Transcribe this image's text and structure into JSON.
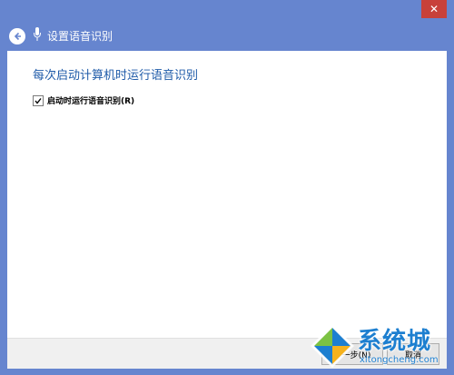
{
  "window": {
    "close_icon": "close-icon",
    "accent": "#6685cf",
    "close_color": "#c8413a"
  },
  "header": {
    "back_icon": "back-arrow-icon",
    "mic_icon": "microphone-icon",
    "title": "设置语音识别"
  },
  "main": {
    "heading": "每次启动计算机时运行语音识别",
    "option": {
      "label": "启动时运行语音识别(R)",
      "checked": true
    }
  },
  "footer": {
    "next_label": "下一步(N)",
    "cancel_label": "取消"
  },
  "watermark": {
    "brand": "系统城",
    "url": "xitongcheng.com"
  }
}
